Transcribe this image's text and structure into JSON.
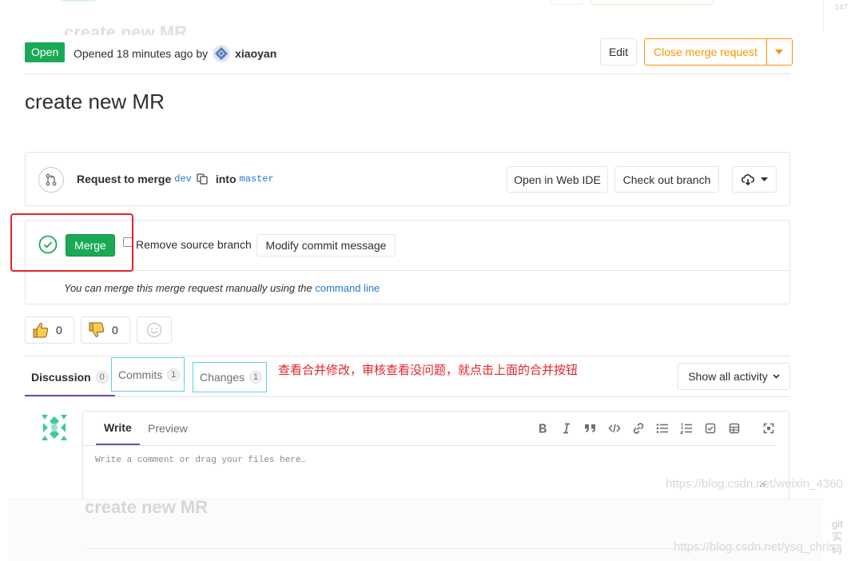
{
  "header": {
    "status_badge": "Open",
    "opened_text": "Opened 18 minutes ago by",
    "author": "xiaoyan",
    "edit_label": "Edit",
    "close_label": "Close merge request",
    "ghost_title": "create new MR",
    "ghost_number": "147"
  },
  "title": "create new MR",
  "merge_info": {
    "request_label": "Request to merge",
    "source_branch": "dev",
    "into_label": "into",
    "target_branch": "master",
    "web_ide_label": "Open in Web IDE",
    "checkout_label": "Check out branch"
  },
  "merge_widget": {
    "merge_label": "Merge",
    "remove_source_label": "Remove source branch",
    "remove_source_checked": false,
    "modify_label": "Modify commit message",
    "manual_text": "You can merge this merge request manually using the",
    "command_line_link": "command line"
  },
  "awards": {
    "thumbs_up_count": "0",
    "thumbs_down_count": "0"
  },
  "tabs": {
    "discussion_label": "Discussion",
    "discussion_count": "0",
    "commits_label": "Commits",
    "commits_count": "1",
    "changes_label": "Changes",
    "changes_count": "1",
    "show_activity_label": "Show all activity"
  },
  "annotation": "查看合并修改，审核查看没问题，就点击上面的合并按钮",
  "comment": {
    "write_tab": "Write",
    "preview_tab": "Preview",
    "placeholder": "Write a comment or drag your files here…"
  },
  "footer": {
    "ghost_title": "create new MR",
    "watermark_1": "https://blog.csdn.net/weixin_4360",
    "watermark_2": "https://blog.csdn.net/ysq_chris",
    "side_text": "git 实 码"
  },
  "colors": {
    "success_green": "#1aaa55",
    "warning_orange": "#fc9403",
    "link_blue": "#1f78d1",
    "annotation_red": "#e4242a",
    "annotation_cyan": "#5fd1dc",
    "active_tab_purple": "#6b4fbb"
  }
}
